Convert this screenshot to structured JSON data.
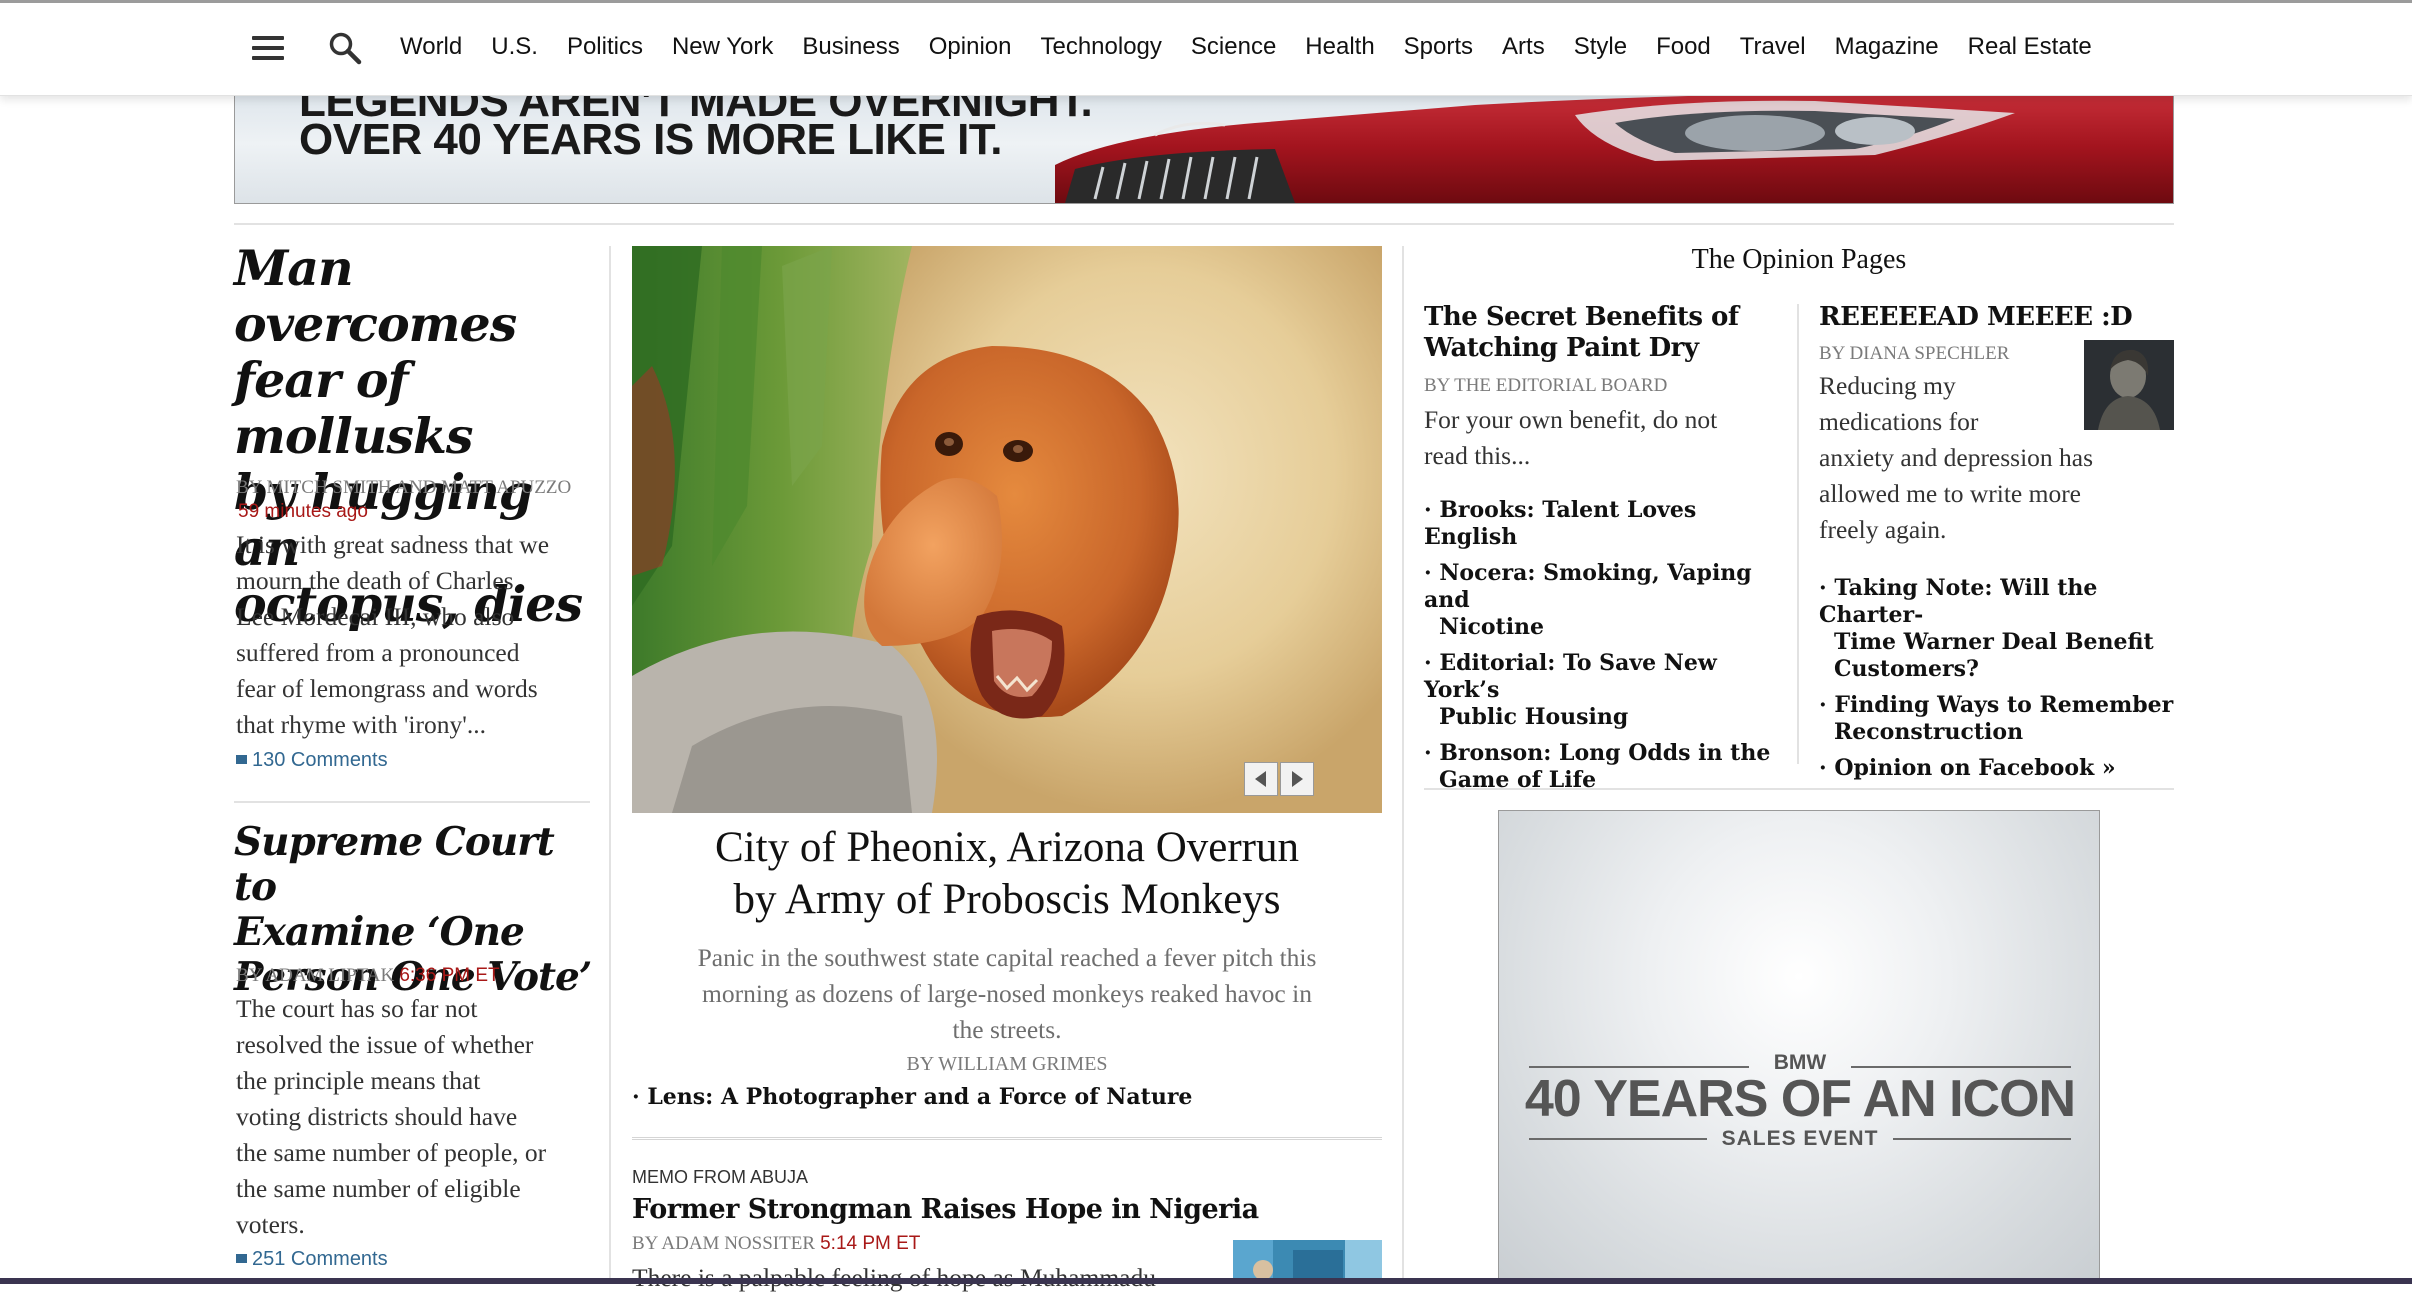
{
  "nav": {
    "items": [
      "World",
      "U.S.",
      "Politics",
      "New York",
      "Business",
      "Opinion",
      "Technology",
      "Science",
      "Health",
      "Sports",
      "Arts",
      "Style",
      "Food",
      "Travel",
      "Magazine",
      "Real Estate"
    ]
  },
  "top_ad": {
    "line1": "LEGENDS AREN'T MADE OVERNIGHT.",
    "line2": "OVER 40 YEARS IS MORE LIKE IT."
  },
  "left": {
    "story1": {
      "headline_lines": [
        "Man overcomes",
        "fear of mollusks",
        "by hugging an",
        "octopus, dies"
      ],
      "byline": "By MITCH SMITH and MATT APUZZO",
      "timestamp": "59 minutes ago",
      "summary_lines": [
        "It is with great sadness that we",
        "mourn the death of Charles",
        "Lee Mordecai III, who also",
        "suffered from a pronounced",
        "fear of lemongrass and words",
        "that rhyme with 'irony'..."
      ],
      "comments": "130 Comments"
    },
    "story2": {
      "headline_lines": [
        "Supreme Court to",
        "Examine ‘One",
        "Person One Vote’"
      ],
      "byline": "By ADAM LIPTAK",
      "timestamp": "6:36 PM ET",
      "summary_lines": [
        "The court has so far not",
        "resolved the issue of whether",
        "the principle means that",
        "voting districts should have",
        "the same number of people, or",
        "the same number of eligible",
        "voters."
      ],
      "comments": "251 Comments"
    }
  },
  "center": {
    "lead": {
      "headline_lines": [
        "City of Pheonix, Arizona Overrun",
        "by Army of Proboscis Monkeys"
      ],
      "summary_lines": [
        "Panic in the southwest state capital reached a fever pitch this",
        "morning as dozens of large-nosed monkeys reaked havoc in",
        "the streets."
      ],
      "byline": "By WILLIAM GRIMES",
      "related": "· Lens: A Photographer and a Force of Nature"
    },
    "second": {
      "kicker": "Memo From Abuja",
      "headline": "Former Strongman Raises Hope in Nigeria",
      "byline": "By ADAM NOSSITER",
      "timestamp": "5:14 PM ET",
      "summary_start": "There is a palpable feeling of hope as Muhammadu"
    }
  },
  "opinion": {
    "section_title": "The Opinion Pages",
    "col1": {
      "headline_lines": [
        "The Secret Benefits of",
        "Watching Paint Dry"
      ],
      "byline": "By THE EDITORIAL BOARD",
      "summary_lines": [
        "For your own benefit, do not",
        "read this..."
      ],
      "links": [
        {
          "lines": [
            "· Brooks: Talent Loves English"
          ]
        },
        {
          "lines": [
            "· Nocera: Smoking, Vaping and",
            "Nicotine"
          ]
        },
        {
          "lines": [
            "· Editorial: To Save New York’s",
            "Public Housing"
          ]
        },
        {
          "lines": [
            "· Bronson: Long Odds in the",
            "Game of Life"
          ]
        }
      ]
    },
    "col2": {
      "headline": "REEEEEAD MEEEE :D",
      "byline": "By DIANA SPECHLER",
      "summary_lines": [
        "Reducing my",
        "medications for",
        "anxiety and depression has",
        "allowed me to write more",
        "freely again."
      ],
      "links": [
        {
          "lines": [
            "· Taking Note: Will the Charter-",
            "Time Warner Deal Benefit",
            "Customers?"
          ]
        },
        {
          "lines": [
            "· Finding Ways to Remember",
            "Reconstruction"
          ]
        },
        {
          "lines": [
            "· Opinion on Facebook »"
          ]
        }
      ]
    }
  },
  "bmw_ad": {
    "brand": "BMW",
    "main": "40 YEARS OF AN ICON",
    "sub": "SALES EVENT"
  },
  "colors": {
    "timestamp": "#a81817",
    "comments_link": "#326891",
    "byline_gray": "#7a7a7a",
    "rule": "#e2e2e2"
  }
}
